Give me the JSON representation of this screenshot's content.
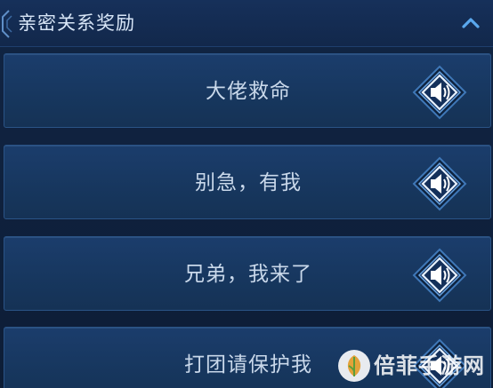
{
  "panel": {
    "title": "亲密关系奖励",
    "collapse_icon": "chevron-up-icon"
  },
  "phrases": [
    {
      "label": "大佬救命",
      "icon": "speaker-icon"
    },
    {
      "label": "别急，有我",
      "icon": "speaker-icon"
    },
    {
      "label": "兄弟，我来了",
      "icon": "speaker-icon"
    },
    {
      "label": "打团请保护我",
      "icon": "speaker-icon"
    }
  ],
  "watermark": {
    "text": "倍菲手游网",
    "logo": "leaf-logo"
  },
  "colors": {
    "background": "#0d1d36",
    "row": "#17375f",
    "accent": "#4a86c8",
    "text": "#c9d8ea"
  }
}
